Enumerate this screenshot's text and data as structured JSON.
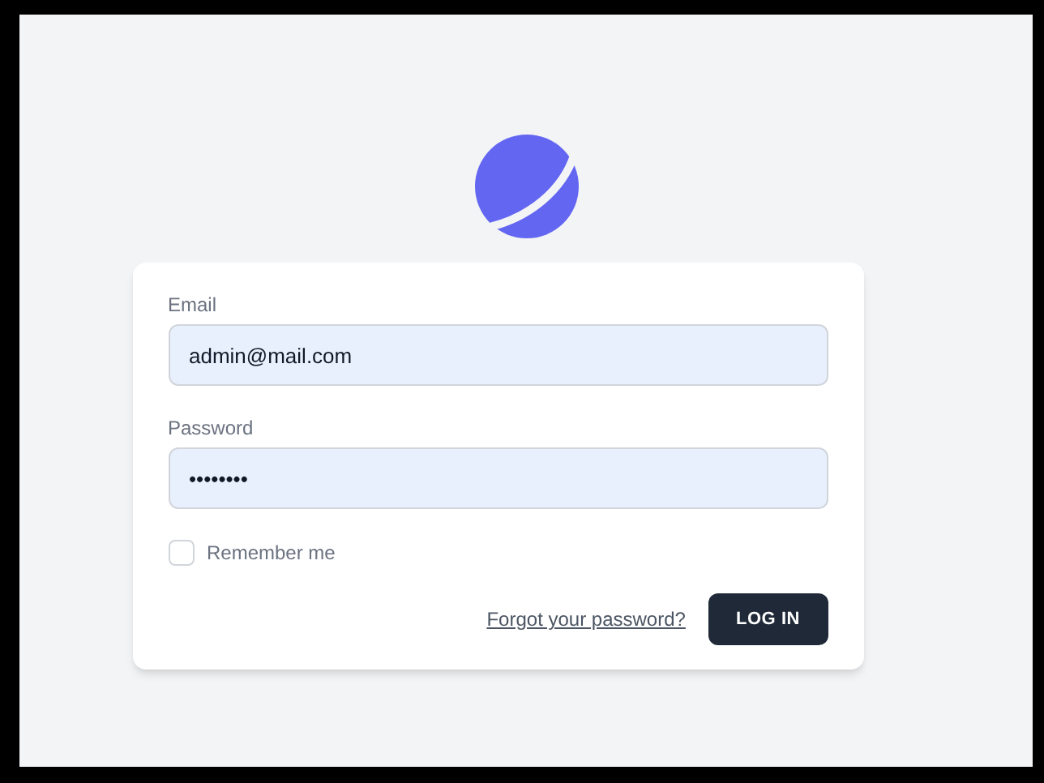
{
  "form": {
    "email": {
      "label": "Email",
      "value": "admin@mail.com"
    },
    "password": {
      "label": "Password",
      "value": "••••••••"
    },
    "remember": {
      "label": "Remember me",
      "checked": false
    },
    "forgot_link": "Forgot your password?",
    "submit": "LOG IN"
  }
}
